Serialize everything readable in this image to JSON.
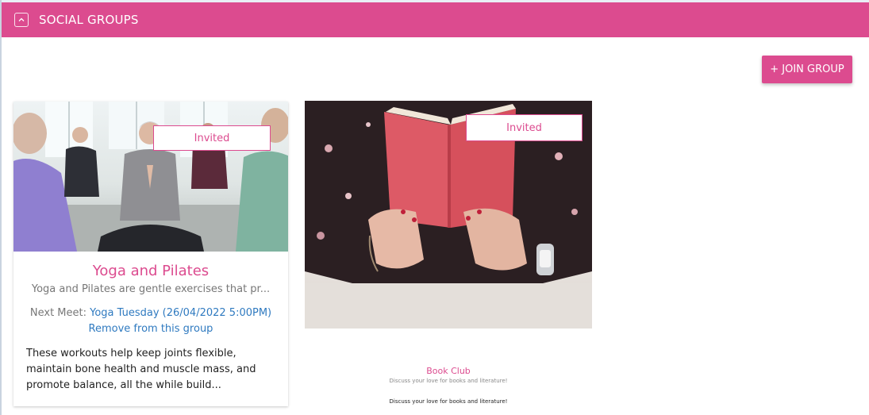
{
  "header": {
    "title": "SOCIAL GROUPS",
    "collapse_icon": "chevron-up-icon",
    "background_color": "#dc4b8f"
  },
  "toolbar": {
    "join_label": "+ JOIN GROUP"
  },
  "groups": [
    {
      "image": "yoga-class-photo",
      "badge": "Invited",
      "name": "Yoga and Pilates",
      "short_description": "Yoga and Pilates are gentle exercises that pr...",
      "next_meet_label": "Next Meet:",
      "next_meet_value": "Yoga Tuesday (26/04/2022 5:00PM)",
      "remove_label": "Remove from this group",
      "body": "These workouts help keep joints flexible, maintain bone health and muscle mass, and promote balance, all the while build..."
    },
    {
      "image": "book-reading-photo",
      "badge": "Invited",
      "name": "Book Club",
      "short_description": "Discuss your love for books and literature!",
      "body": "Discuss your love for books and literature!"
    }
  ],
  "colors": {
    "accent": "#dc4b8f",
    "link": "#2f7ac0",
    "muted_text": "#777777"
  }
}
